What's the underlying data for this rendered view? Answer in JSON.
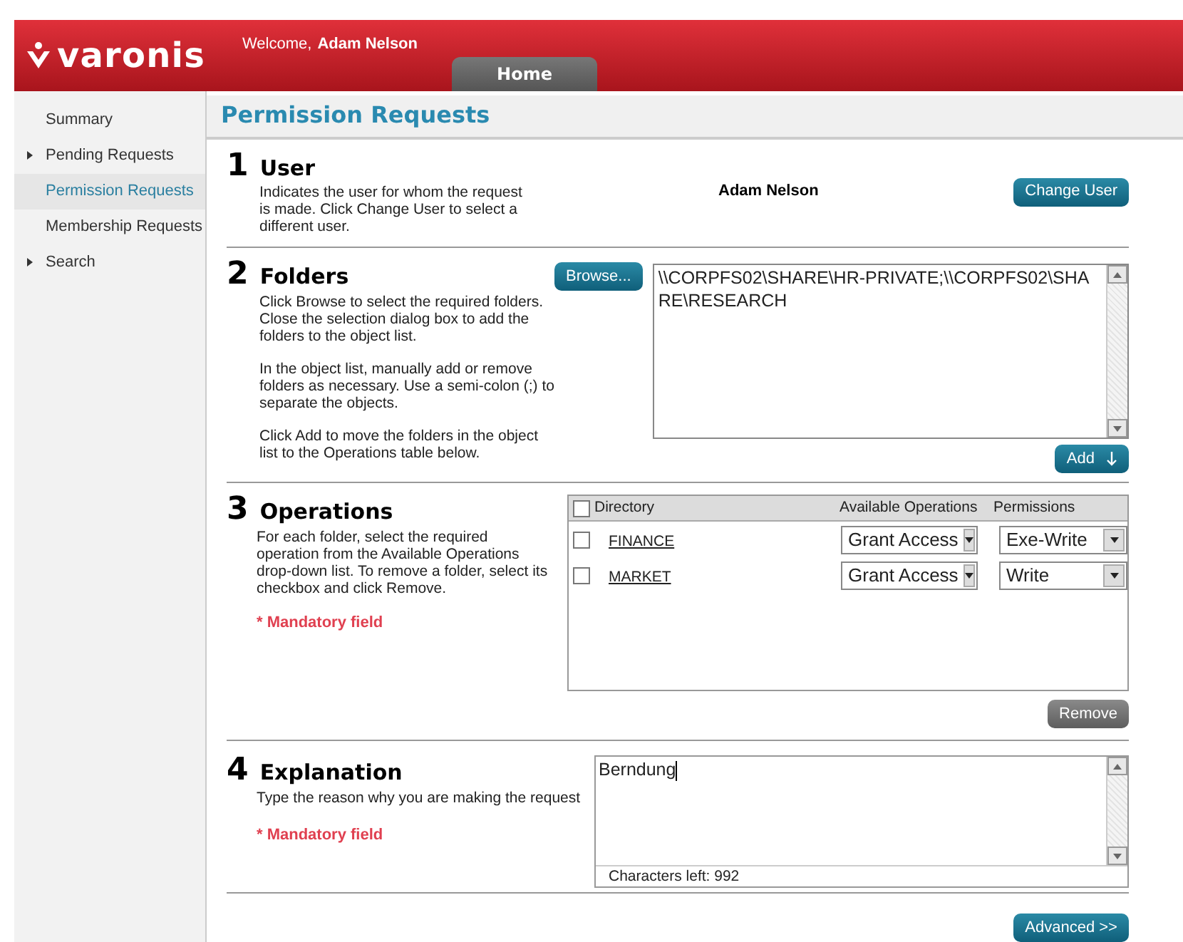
{
  "header": {
    "logo": "varonis",
    "welcome": "Welcome,",
    "user": "Adam Nelson",
    "tabs": [
      {
        "label": "Home",
        "selected": true
      }
    ]
  },
  "sidebar": {
    "items": [
      {
        "label": "Summary",
        "kind": "link",
        "selected": false
      },
      {
        "label": "Pending Requests",
        "kind": "group",
        "selected": false
      },
      {
        "label": "Permission Requests",
        "kind": "link",
        "selected": true
      },
      {
        "label": "Membership Requests",
        "kind": "link",
        "selected": false
      },
      {
        "label": "Search",
        "kind": "group",
        "selected": false
      }
    ]
  },
  "page_title": "Permission Requests",
  "user_section": {
    "number": "1",
    "title": "User",
    "description": "Indicates the user for whom the request is made. Click Change User to select a different user.",
    "user": "Adam Nelson",
    "button": "Change User"
  },
  "folders_section": {
    "number": "2",
    "title": "Folders",
    "paragraphs": [
      "Click Browse to select the required folders. Close the selection dialog box to add the folders to the object list.",
      "In the object list, manually add or remove folders as necessary. Use a semi-colon (;) to separate the objects.",
      "Click Add to move the folders in the object list to the Operations table below."
    ],
    "browse_button": "Browse...",
    "object_list": "\\\\CORPFS02\\SHARE\\HR-PRIVATE;\\\\CORPFS02\\SHARE\\RESEARCH",
    "add_button": "Add"
  },
  "operations_section": {
    "number": "3",
    "title": "Operations",
    "description": "For each folder, select the required operation from the Available Operations drop-down list. To remove a folder, select its checkbox and click Remove.",
    "mandatory": "* Mandatory field",
    "table": {
      "select_all_checked": false,
      "columns": [
        "Directory",
        "Available Operations",
        "Permissions"
      ],
      "rows": [
        {
          "checked": false,
          "directory": "FINANCE",
          "operation": "Grant Access",
          "permission": "Exe-Write"
        },
        {
          "checked": false,
          "directory": "MARKET",
          "operation": "Grant Access",
          "permission": "Write"
        }
      ]
    },
    "remove_button": "Remove"
  },
  "explanation_section": {
    "number": "4",
    "title": "Explanation",
    "description": "Type the reason why you are making the request",
    "mandatory": "* Mandatory field",
    "value": "Berndung",
    "characters_left": "Characters left: 992"
  },
  "advanced_button": "Advanced >>"
}
